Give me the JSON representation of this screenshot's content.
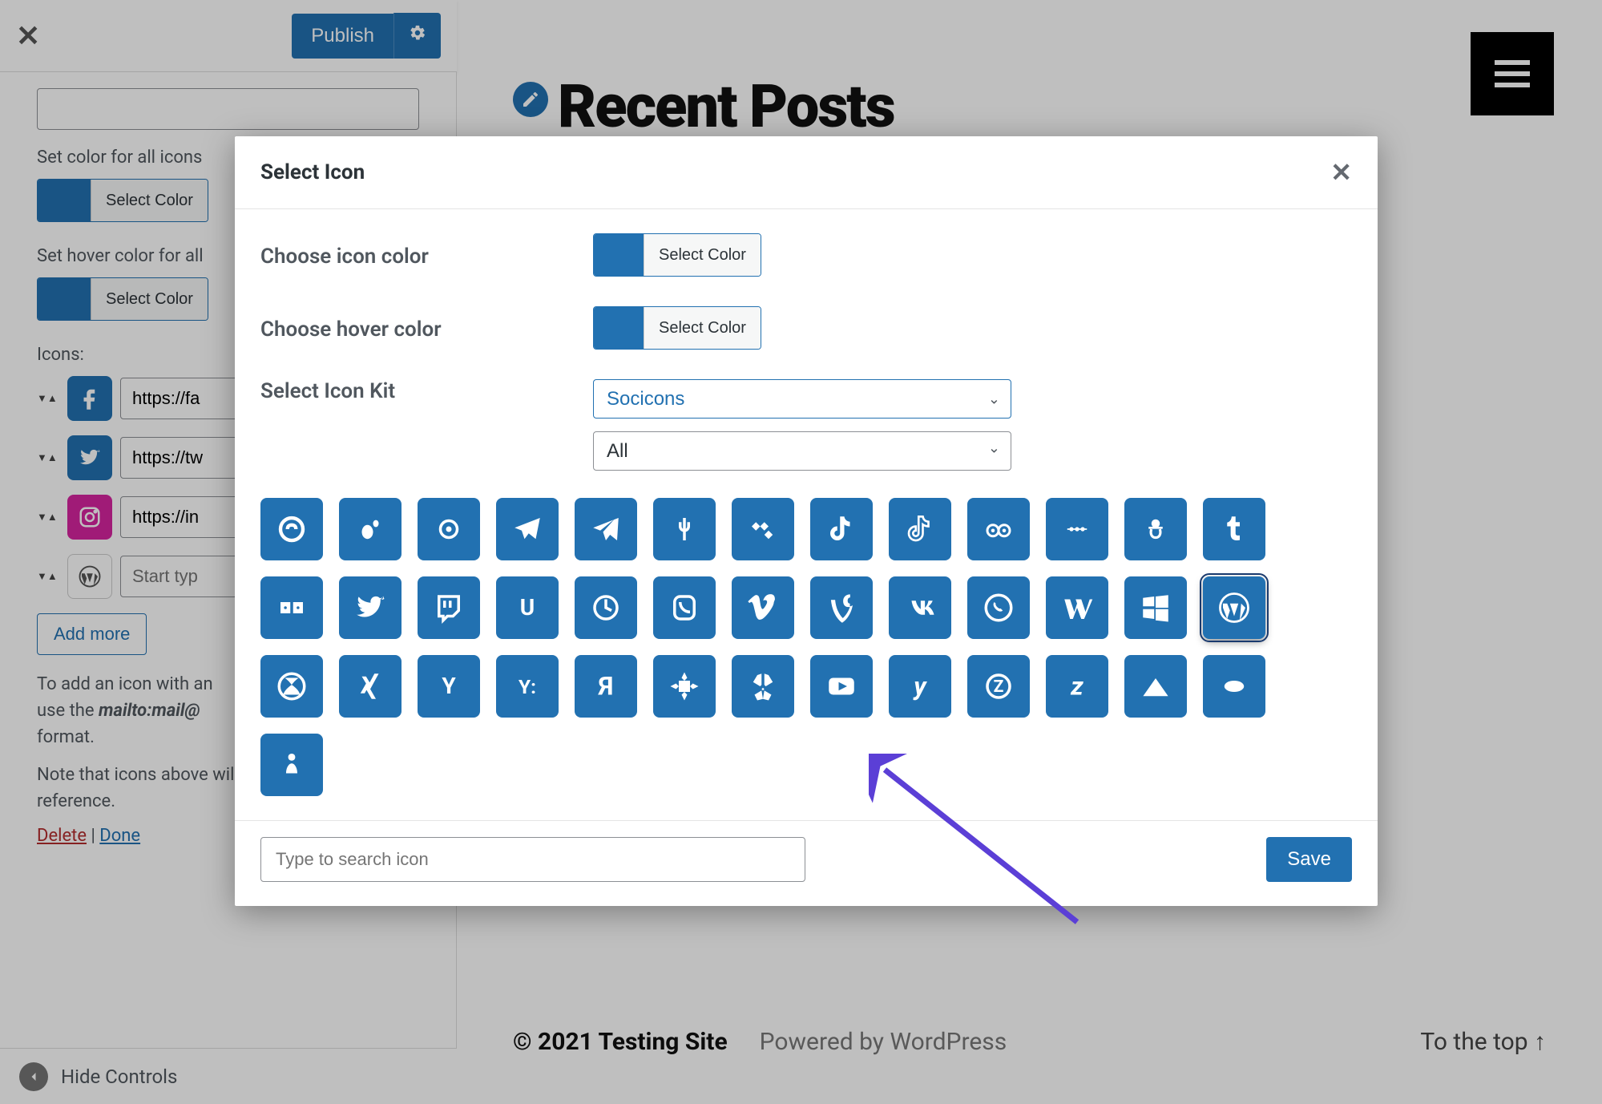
{
  "topbar": {
    "publish_label": "Publish"
  },
  "sidebar": {
    "set_color_label": "Set color for all icons",
    "select_color_label": "Select Color",
    "set_hover_label": "Set hover color for all",
    "icons_label": "Icons:",
    "icons": [
      {
        "name": "facebook",
        "url": "https://fa",
        "bg": "#2271b1"
      },
      {
        "name": "twitter",
        "url": "https://tw",
        "bg": "#2271b1"
      },
      {
        "name": "instagram",
        "url": "https://in",
        "bg": "#d6249f"
      },
      {
        "name": "wordpress",
        "url": "",
        "placeholder": "Start typ"
      }
    ],
    "add_more_label": "Add more",
    "help1_a": "To add an icon with an",
    "help1_b": "use the ",
    "help1_em": "mailto:mail@",
    "help1_c": " format.",
    "help2": "Note that icons above will look on front-end reference.",
    "delete_label": "Delete",
    "done_label": "Done",
    "reorder_label": "Reorder"
  },
  "hide_controls_label": "Hide Controls",
  "preview": {
    "title": "Recent Posts",
    "copyright": "© 2021 Testing Site",
    "powered": "Powered by WordPress",
    "to_top": "To the top ↑"
  },
  "modal": {
    "title": "Select Icon",
    "icon_color_label": "Choose icon color",
    "hover_color_label": "Choose hover color",
    "select_color_label": "Select Color",
    "select_kit_label": "Select Icon Kit",
    "kit_value": "Socicons",
    "kit_filter_value": "All",
    "icon_color": "#2271b1",
    "hover_color": "#2271b1",
    "search_placeholder": "Type to search icon",
    "save_label": "Save",
    "selected_index": 25,
    "icons": [
      "stumbleupon",
      "swarm",
      "symphony",
      "telegram",
      "telegram-plane",
      "fork",
      "tidal",
      "tiktok",
      "tiktok-alt",
      "tripadvisor",
      "trip",
      "triller",
      "tumblr",
      "tunein",
      "twitter",
      "twitch",
      "udemy",
      "unsplash",
      "viber",
      "vimeo",
      "vine",
      "vk",
      "whatsapp",
      "wikipedia",
      "windows",
      "wordpress",
      "xbox",
      "xing",
      "yahoo",
      "yammer",
      "yandex",
      "yelp-alt",
      "yelp",
      "youtube",
      "younow",
      "zazzle",
      "zerply",
      "zillow",
      "zomato",
      "zynga"
    ]
  },
  "chart_data": null
}
